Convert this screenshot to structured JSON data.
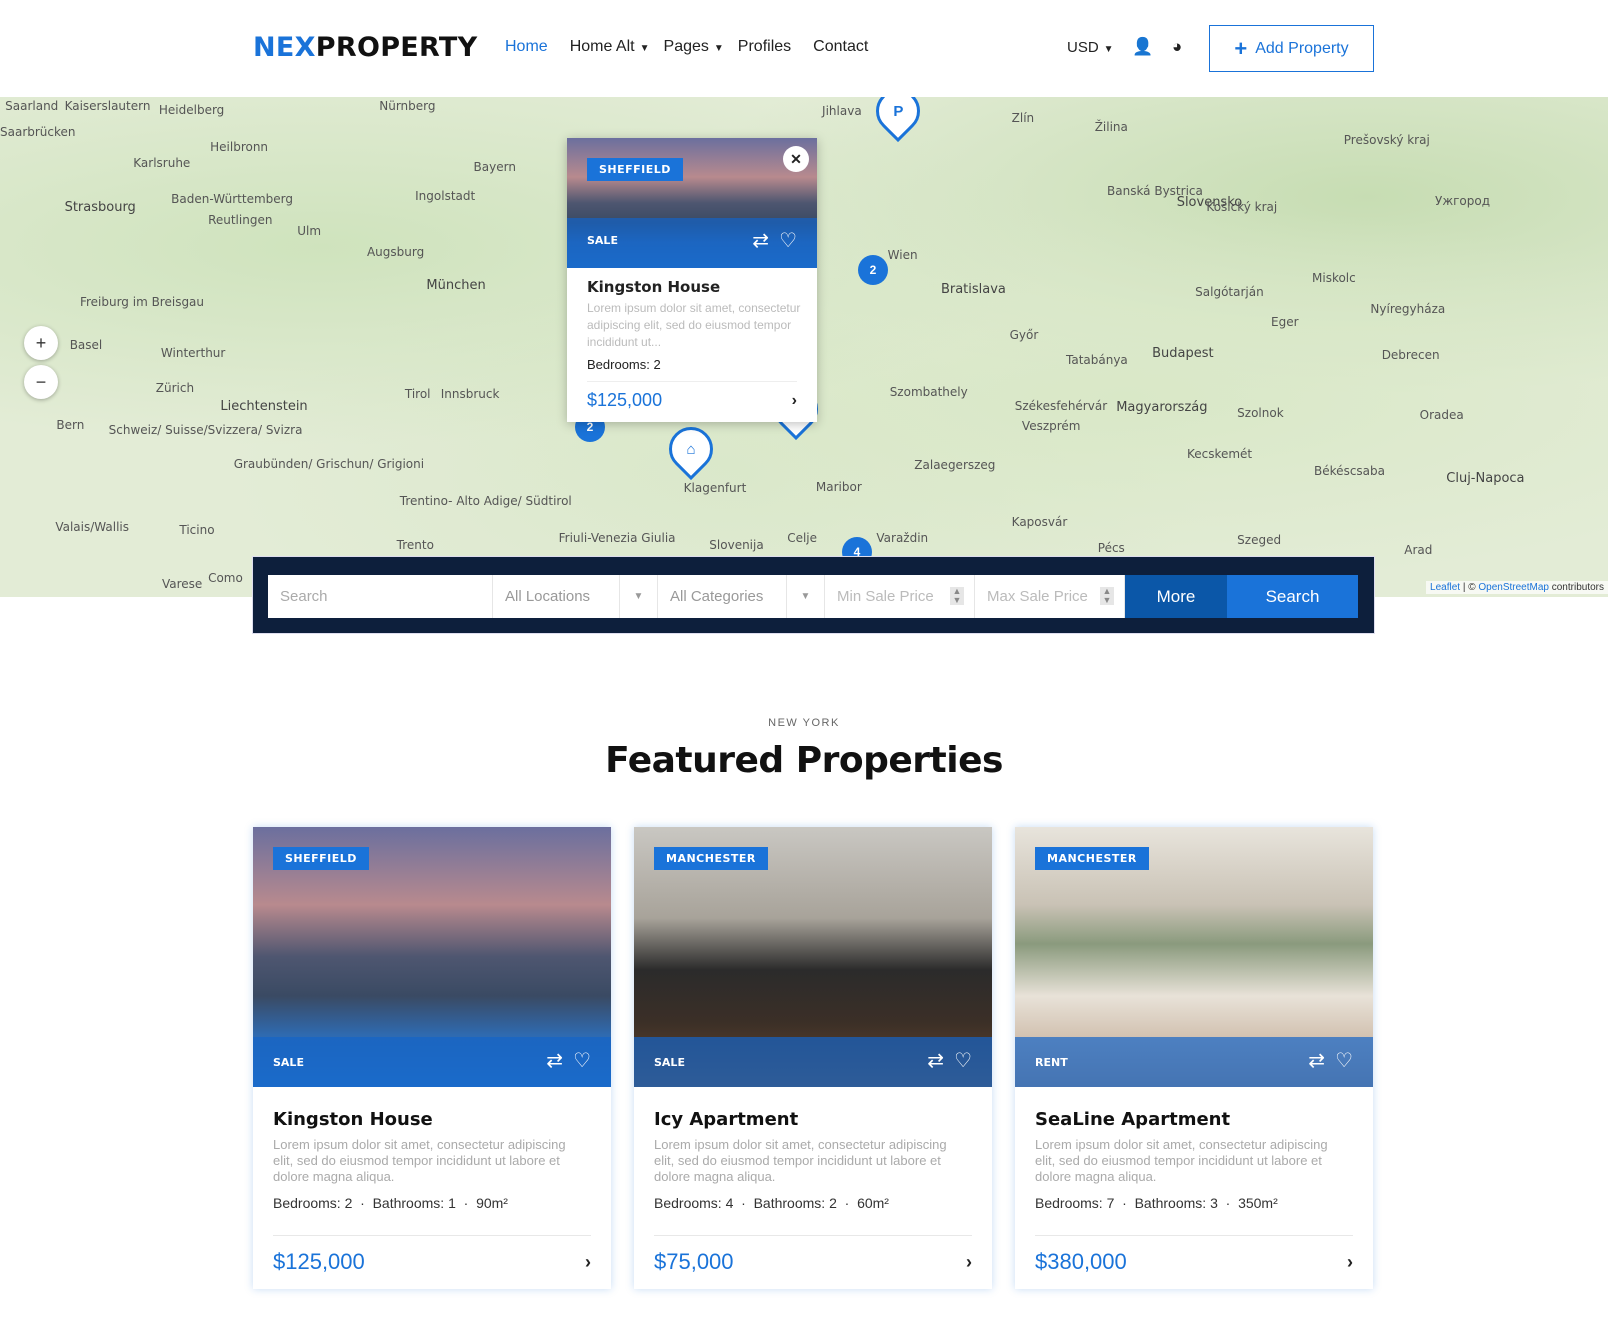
{
  "header": {
    "logo_a": "NEX",
    "logo_b": "PROPERTY",
    "nav": [
      {
        "label": "Home",
        "active": true
      },
      {
        "label": "Home Alt",
        "dropdown": true
      },
      {
        "label": "Pages",
        "dropdown": true
      },
      {
        "label": "Profiles"
      },
      {
        "label": "Contact"
      }
    ],
    "currency": "USD",
    "add_property": "Add Property"
  },
  "map": {
    "cities": [
      "Saarland",
      "Kaiserslautern",
      "Heidelberg",
      "Nürnberg",
      "Saarbrücken",
      "Heilbronn",
      "Karlsruhe",
      "Bayern",
      "Strasbourg",
      "Baden-Württemberg",
      "Reutlingen",
      "Ingolstadt",
      "Ulm",
      "Augsburg",
      "München",
      "Freiburg im Breisgau",
      "Basel",
      "Winterthur",
      "Zürich",
      "Liechtenstein",
      "Tirol",
      "Innsbruck",
      "Bern",
      "Schweiz/ Suisse/Svizzera/ Svizra",
      "Graubünden/ Grischun/ Grigioni",
      "Trentino- Alto Adige/ Südtirol",
      "Valais/Wallis",
      "Ticino",
      "Trento",
      "Varese",
      "Como",
      "Friuli-Venezia Giulia",
      "Slovenija",
      "Celje",
      "Maribor",
      "Klagenfurt",
      "Varaždin",
      "Wien",
      "Bratislava",
      "Jihlava",
      "Zlín",
      "Žilina",
      "Slovensko",
      "Banská Bystrica",
      "Győr",
      "Budapest",
      "Tatabánya",
      "Magyarország",
      "Székesfehérvár",
      "Veszprém",
      "Szombathely",
      "Zalaegerszeg",
      "Kaposvár",
      "Pécs",
      "Szeged",
      "Kecskemét",
      "Szolnok",
      "Debrecen",
      "Miskolc",
      "Eger",
      "Salgótarján",
      "Nyíregyháza",
      "Oradea",
      "Cluj-Napoca",
      "Arad",
      "Békéscsaba",
      "Košický kraj",
      "Prešovský kraj",
      "Ужгород"
    ],
    "clusters": [
      "2",
      "2",
      "4"
    ],
    "attribution_leaflet": "Leaflet",
    "attribution_osm": "OpenStreetMap",
    "attribution_rest": "contributors",
    "zoom_in": "+",
    "zoom_out": "−"
  },
  "popup": {
    "location": "SHEFFIELD",
    "status": "SALE",
    "title": "Kingston House",
    "desc": "Lorem ipsum dolor sit amet, consectetur adipiscing elit, sed do eiusmod tempor incididunt ut...",
    "bedrooms": "Bedrooms: 2",
    "price": "$125,000"
  },
  "search": {
    "placeholder": "Search",
    "location": "All Locations",
    "category": "All Categories",
    "min_price": "Min Sale Price",
    "max_price": "Max Sale Price",
    "more": "More",
    "submit": "Search"
  },
  "featured": {
    "eyebrow": "NEW YORK",
    "title": "Featured Properties",
    "cards": [
      {
        "location": "SHEFFIELD",
        "status": "SALE",
        "title": "Kingston House",
        "desc": "Lorem ipsum dolor sit amet, consectetur adipiscing elit, sed do eiusmod tempor incididunt ut labore et dolore magna aliqua.",
        "meta": "Bedrooms: 2  ·  Bathrooms: 1  ·  90m²",
        "price": "$125,000"
      },
      {
        "location": "MANCHESTER",
        "status": "SALE",
        "title": "Icy Apartment",
        "desc": "Lorem ipsum dolor sit amet, consectetur adipiscing elit, sed do eiusmod tempor incididunt ut labore et dolore magna aliqua.",
        "meta": "Bedrooms: 4  ·  Bathrooms: 2  ·  60m²",
        "price": "$75,000"
      },
      {
        "location": "MANCHESTER",
        "status": "RENT",
        "title": "SeaLine Apartment",
        "desc": "Lorem ipsum dolor sit amet, consectetur adipiscing elit, sed do eiusmod tempor incididunt ut labore et dolore magna aliqua.",
        "meta": "Bedrooms: 7  ·  Bathrooms: 3  ·  350m²",
        "price": "$380,000"
      }
    ]
  },
  "colors": {
    "accent": "#1a73d9",
    "navy": "#0d1f3c",
    "more": "#0b57a8"
  }
}
